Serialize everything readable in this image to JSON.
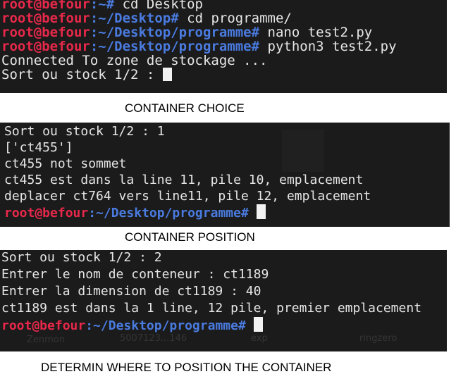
{
  "terminal1": {
    "lines": [
      {
        "user": "root@befour",
        "path": ":~#",
        "cmd": " cd Desktop"
      },
      {
        "user": "root@befour",
        "path": ":~/Desktop#",
        "cmd": " cd programme/"
      },
      {
        "user": "root@befour",
        "path": ":~/Desktop/programme#",
        "cmd": " nano test2.py"
      },
      {
        "user": "root@befour",
        "path": ":~/Desktop/programme#",
        "cmd": " python3 test2.py"
      },
      {
        "text": "Connected To zone de stockage ..."
      },
      {
        "text": "Sort ou stock 1/2 : "
      }
    ]
  },
  "caption1": "CONTAINER CHOICE",
  "terminal2": {
    "lines": [
      "Sort ou stock 1/2 : 1",
      "['ct455']",
      "ct455 not sommet",
      "ct455 est dans la line 11, pile 10, emplacement",
      "deplacer ct764 vers line11, pile 12, emplacement"
    ],
    "prompt": {
      "user": "root@befour",
      "path": ":~/Desktop/programme#"
    }
  },
  "caption2": "CONTAINER POSITION",
  "terminal3": {
    "lines": [
      "Sort ou stock 1/2 : 2",
      "Entrer le nom de conteneur : ct1189",
      "Entrer la dimension de ct1189 : 40",
      "ct1189 est dans la 1 line, 12 pile, premier emplacement"
    ],
    "prompt": {
      "user": "root@befour",
      "path": ":~/Desktop/programme#"
    },
    "background_labels": [
      "Zenmon",
      "5007123...146",
      "exp",
      "ringzero"
    ]
  },
  "caption3": "DETERMIN WHERE TO POSITION THE CONTAINER"
}
